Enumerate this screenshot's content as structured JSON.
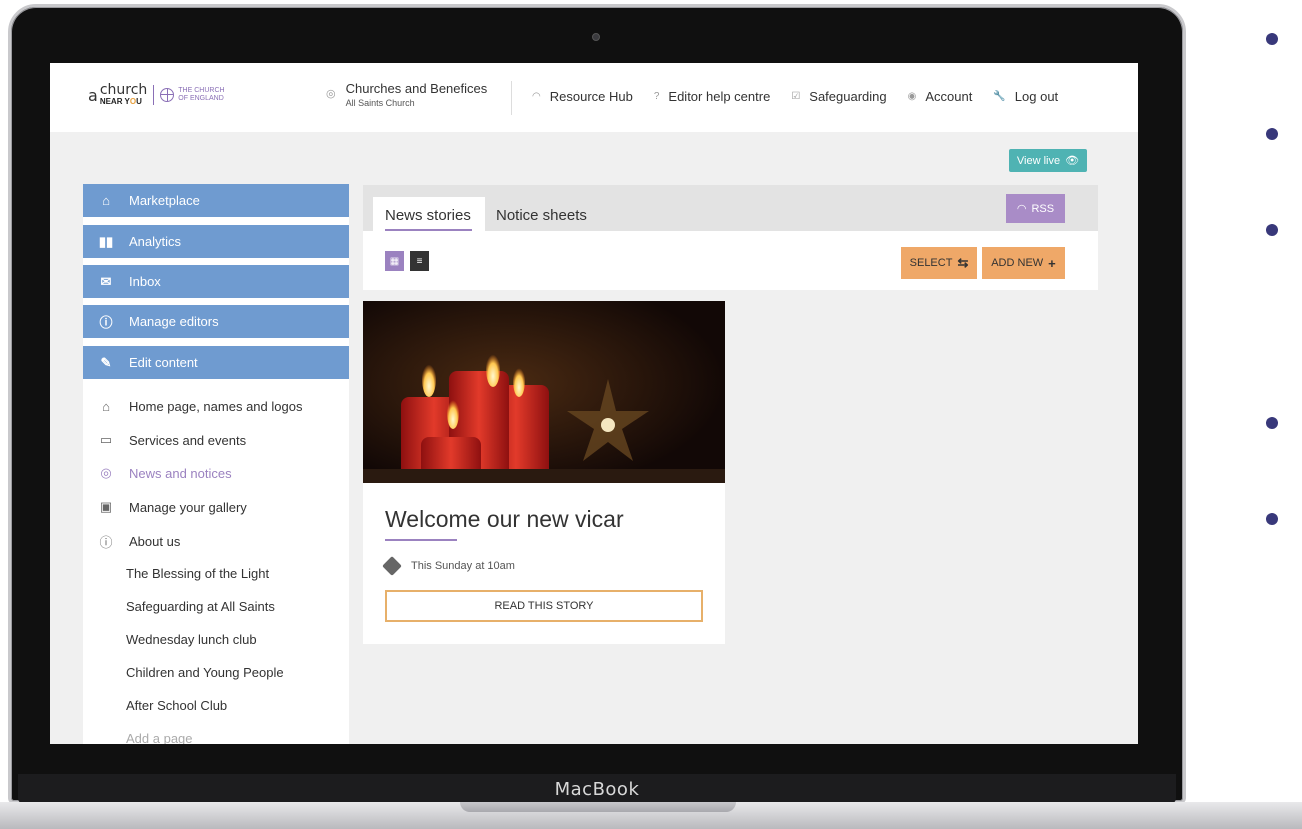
{
  "device": {
    "brand": "MacBook"
  },
  "header": {
    "logo": {
      "prefix": "a",
      "church": "church",
      "near_you": "NEAR Y",
      "you_o": "O",
      "you_u": "U",
      "coe_line1": "THE CHURCH",
      "coe_line2": "OF ENGLAND"
    },
    "churches": {
      "title": "Churches and Benefices",
      "subtitle": "All Saints Church"
    },
    "nav": [
      {
        "label": "Resource Hub",
        "icon": "rss-icon"
      },
      {
        "label": "Editor help centre",
        "icon": "help-icon"
      },
      {
        "label": "Safeguarding",
        "icon": "checkbox-icon"
      },
      {
        "label": "Account",
        "icon": "account-icon"
      },
      {
        "label": "Log out",
        "icon": "key-icon"
      }
    ]
  },
  "view_live": {
    "label": "View live"
  },
  "sidebar": {
    "buttons": [
      {
        "label": "Marketplace",
        "icon": "basket-icon"
      },
      {
        "label": "Analytics",
        "icon": "bar-chart-icon"
      },
      {
        "label": "Inbox",
        "icon": "envelope-icon"
      },
      {
        "label": "Manage editors",
        "icon": "user-circle-icon"
      },
      {
        "label": "Edit content",
        "icon": "pencil-icon"
      }
    ],
    "links": [
      {
        "label": "Home page, names and logos",
        "icon": "home-icon"
      },
      {
        "label": "Services and events",
        "icon": "calendar-icon"
      },
      {
        "label": "News and notices",
        "icon": "rss-icon"
      },
      {
        "label": "Manage your gallery",
        "icon": "gallery-icon"
      },
      {
        "label": "About us",
        "icon": "info-icon"
      }
    ],
    "sub_pages": [
      "The Blessing of the Light",
      "Safeguarding at All Saints",
      "Wednesday lunch club",
      "Children and Young People",
      "After School Club"
    ],
    "add_page": "Add a page"
  },
  "tabs": {
    "active": "News stories",
    "other": "Notice sheets"
  },
  "rss": {
    "label": "RSS"
  },
  "toolbar": {
    "select_label": "SELECT",
    "add_new_label": "ADD NEW"
  },
  "story": {
    "title": "Welcome our new vicar",
    "meta": "This Sunday at 10am",
    "read_label": "READ THIS STORY"
  },
  "colors": {
    "sidebar_blue": "#6f9bd0",
    "accent_purple": "#9b82c0",
    "orange": "#efa868",
    "teal": "#4fb3b3",
    "bullet": "#38387a"
  }
}
